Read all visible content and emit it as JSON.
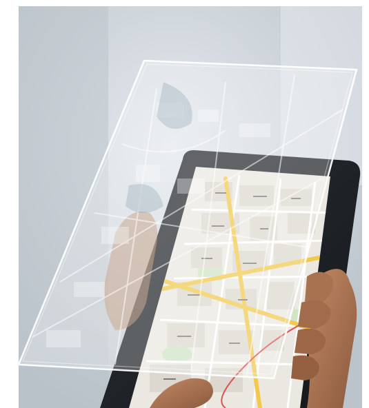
{
  "image": {
    "description_free": true,
    "colors": {
      "background_top": "#c9d0d6",
      "background_bottom": "#b9c2c9",
      "tablet_bezel": "#1d2024",
      "map_land": "#e9e6df",
      "map_park": "#cfe5c4",
      "map_water": "#a9c7e2",
      "road_major": "#f2c94c",
      "road_minor": "#ffffff",
      "hologram": "#ffffff",
      "skin": "#b07a5a",
      "route_line": "#d9534f"
    },
    "icons": [
      "tablet",
      "map",
      "hologram-map",
      "hand"
    ]
  }
}
